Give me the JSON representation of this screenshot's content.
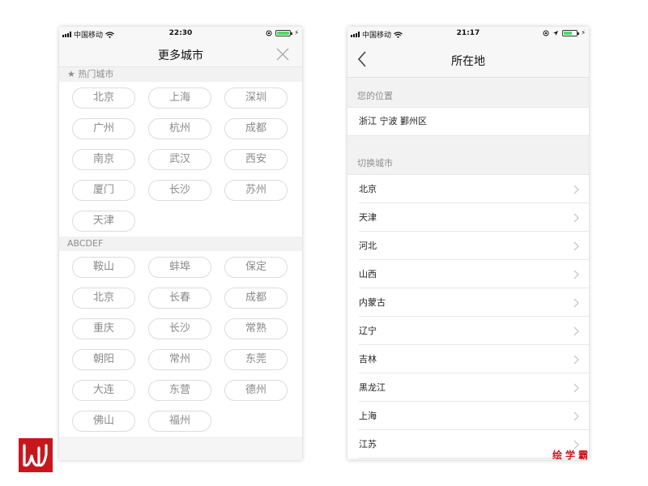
{
  "left_phone": {
    "status": {
      "carrier": "中国移动",
      "time": "22:30"
    },
    "title": "更多城市",
    "hot_section": {
      "header": "★ 热门城市",
      "cities": [
        "北京",
        "上海",
        "深圳",
        "广州",
        "杭州",
        "成都",
        "南京",
        "武汉",
        "西安",
        "厦门",
        "长沙",
        "苏州",
        "天津"
      ]
    },
    "alpha_section": {
      "header": "ABCDEF",
      "cities": [
        "鞍山",
        "蚌埠",
        "保定",
        "北京",
        "长春",
        "成都",
        "重庆",
        "长沙",
        "常熟",
        "朝阳",
        "常州",
        "东莞",
        "大连",
        "东营",
        "德州",
        "佛山",
        "福州"
      ]
    }
  },
  "right_phone": {
    "status": {
      "carrier": "中国移动",
      "time": "21:17"
    },
    "title": "所在地",
    "location_header": "您的位置",
    "location_value": "浙江 宁波 鄞州区",
    "switch_header": "切换城市",
    "cities": [
      "北京",
      "天津",
      "河北",
      "山西",
      "内蒙古",
      "辽宁",
      "吉林",
      "黑龙江",
      "上海",
      "江苏"
    ]
  },
  "watermark": "绘学霸",
  "colors": {
    "accent_red": "#c8161d",
    "battery_green": "#4cd964",
    "chip_border": "#dcdcdc"
  },
  "icons": [
    "signal-icon",
    "wifi-icon",
    "battery-icon",
    "charging-icon",
    "location-arrow-icon",
    "orientation-lock-icon",
    "close-icon",
    "back-chevron-icon",
    "chevron-right-icon",
    "brand-logo-icon"
  ]
}
